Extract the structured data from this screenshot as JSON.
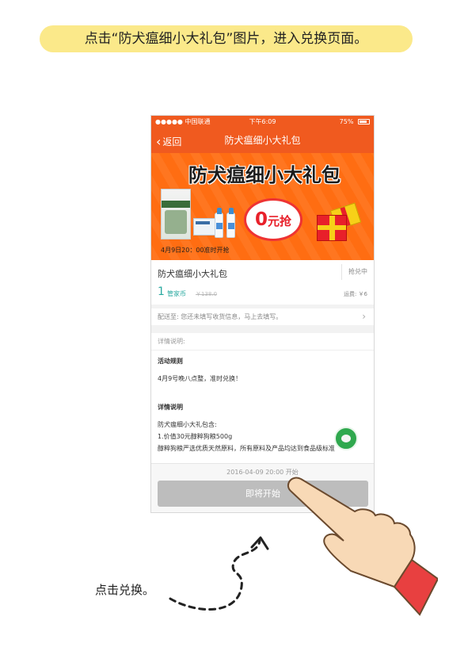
{
  "instruction": "点击“防犬瘟细小大礼包”图片，进入兑换页面。",
  "status_bar": {
    "carrier": "●●●●● 中国联通",
    "time": "下午6:09",
    "battery": "75%"
  },
  "nav": {
    "back_label": "返回",
    "title": "防犬瘟细小大礼包"
  },
  "banner": {
    "headline": "防犬瘟细小大礼包",
    "price_big": "0",
    "price_small": "元抢",
    "note": "4月9日20：00准时开抢"
  },
  "product": {
    "name": "防犬瘟细小大礼包",
    "status": "抢兑中",
    "points": "1",
    "points_unit": "管家币",
    "original_price": "￥138.0",
    "shipping": "运费: ￥6"
  },
  "address": {
    "text": "配送至: 您还未填写收货信息，马上去填写。"
  },
  "detail": {
    "header": "详情说明:",
    "rules_title": "活动规则",
    "rules_text": "4月9号晚八点整，准时兑换！",
    "desc_title": "详情说明",
    "desc_line1": "防犬瘟细小大礼包含:",
    "desc_line2": "1.价值30元醇粹狗粮500g",
    "desc_line3": "醇粹狗粮严选优质天然原料，所有原料及产品均达到食品级标准"
  },
  "footer": {
    "start_time": "2016-04-09 20:00 开始",
    "button": "即将开始"
  },
  "caption": "点击兑换。",
  "colors": {
    "brand": "#f05a1f",
    "instruction_bg": "#fbe98a",
    "accent": "#2aa9a0",
    "disabled": "#bdbdbd"
  }
}
